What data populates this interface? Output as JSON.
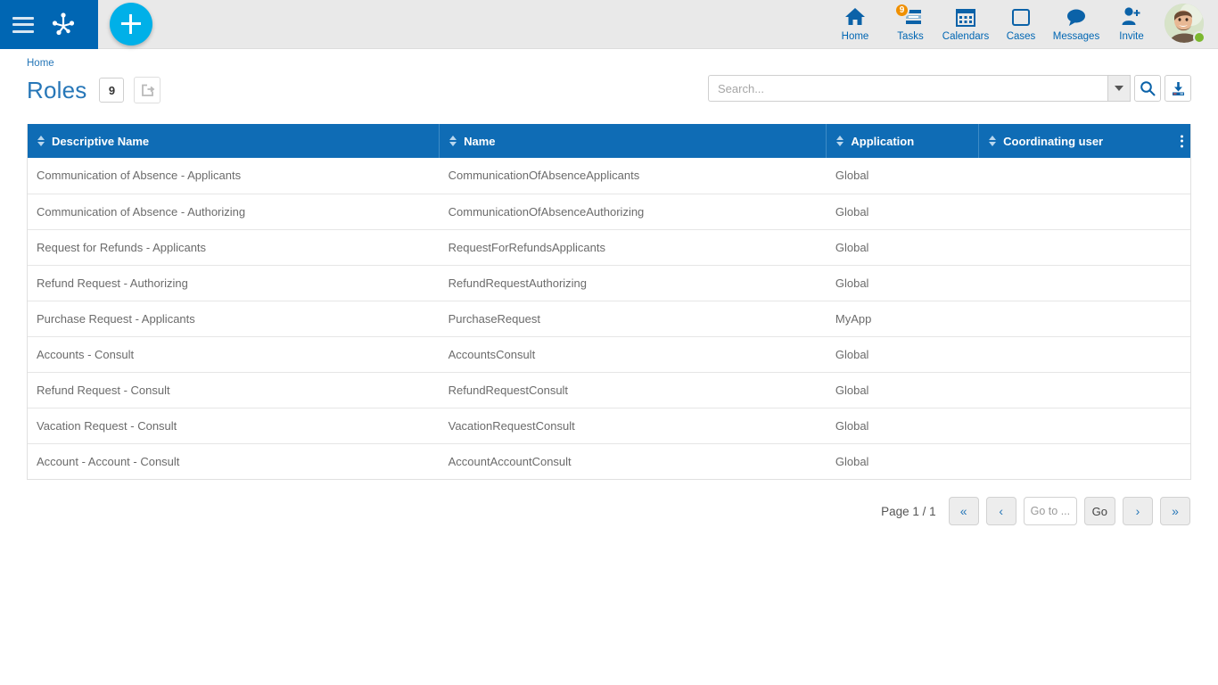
{
  "topbar": {
    "menu_label": "Menu",
    "logo_label": "app-logo",
    "add_label": "+",
    "nav": [
      {
        "label": "Home",
        "icon": "home-icon"
      },
      {
        "label": "Tasks",
        "icon": "tasks-icon",
        "badge": "9"
      },
      {
        "label": "Calendars",
        "icon": "calendar-icon"
      },
      {
        "label": "Cases",
        "icon": "cases-icon"
      },
      {
        "label": "Messages",
        "icon": "messages-icon"
      },
      {
        "label": "Invite",
        "icon": "invite-user-icon"
      }
    ],
    "avatar_alt": "user-avatar",
    "status": "online"
  },
  "breadcrumb": {
    "label": "Home"
  },
  "header": {
    "title": "Roles",
    "count": "9",
    "share_icon": "share-export-icon"
  },
  "search": {
    "placeholder": "Search...",
    "value": "",
    "dropdown_icon": "chevron-down-icon",
    "search_icon": "search-icon",
    "export_icon": "download-export-icon"
  },
  "table": {
    "columns": [
      {
        "label": "Descriptive Name"
      },
      {
        "label": "Name"
      },
      {
        "label": "Application"
      },
      {
        "label": "Coordinating user"
      }
    ],
    "menu_icon": "more-options-icon",
    "rows": [
      {
        "descriptive_name": "Communication of Absence - Applicants",
        "name": "CommunicationOfAbsenceApplicants",
        "application": "Global",
        "coordinating_user": ""
      },
      {
        "descriptive_name": "Communication of Absence - Authorizing",
        "name": "CommunicationOfAbsenceAuthorizing",
        "application": "Global",
        "coordinating_user": ""
      },
      {
        "descriptive_name": "Request for Refunds - Applicants",
        "name": "RequestForRefundsApplicants",
        "application": "Global",
        "coordinating_user": ""
      },
      {
        "descriptive_name": "Refund Request - Authorizing",
        "name": "RefundRequestAuthorizing",
        "application": "Global",
        "coordinating_user": ""
      },
      {
        "descriptive_name": "Purchase Request - Applicants",
        "name": "PurchaseRequest",
        "application": "MyApp",
        "coordinating_user": ""
      },
      {
        "descriptive_name": "Accounts - Consult",
        "name": "AccountsConsult",
        "application": "Global",
        "coordinating_user": ""
      },
      {
        "descriptive_name": "Refund Request - Consult",
        "name": "RefundRequestConsult",
        "application": "Global",
        "coordinating_user": ""
      },
      {
        "descriptive_name": "Vacation Request - Consult",
        "name": "VacationRequestConsult",
        "application": "Global",
        "coordinating_user": ""
      },
      {
        "descriptive_name": "Account - Account - Consult",
        "name": "AccountAccountConsult",
        "application": "Global",
        "coordinating_user": ""
      }
    ]
  },
  "pagination": {
    "page_label": "Page 1 / 1",
    "first": "«",
    "prev": "‹",
    "goto_placeholder": "Go to ...",
    "goto_value": "",
    "go_label": "Go",
    "next": "›",
    "last": "»"
  },
  "colors": {
    "brand_blue": "#0066b3",
    "table_header_blue": "#0f6cb5",
    "accent_cyan": "#00b0e8",
    "badge_orange": "#f09000",
    "status_green": "#7cb82f",
    "link_blue": "#2777b8"
  }
}
